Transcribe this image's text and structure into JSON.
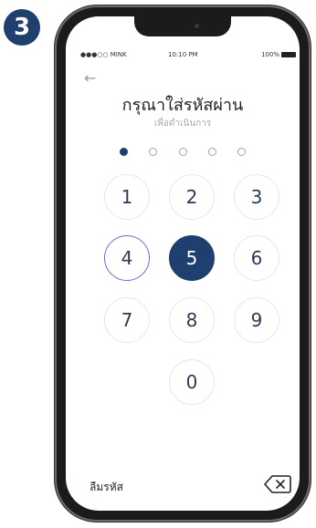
{
  "step_badge": "3",
  "status_bar": {
    "carrier": "●●●○○ MINK",
    "time": "10:10 PM",
    "battery": "100%"
  },
  "back_icon": "back-arrow-icon",
  "title": "กรุณาใส่รหัสผ่าน",
  "subtitle": "เพื่อดำเนินการ",
  "pin": {
    "length": 5,
    "filled": 1
  },
  "keypad": {
    "keys": [
      "1",
      "2",
      "3",
      "4",
      "5",
      "6",
      "7",
      "8",
      "9",
      "0"
    ],
    "pressed": "5",
    "focused": "4"
  },
  "footer": {
    "forgot_label": "ลืมรหัส",
    "backspace_icon": "backspace-icon"
  },
  "colors": {
    "accent": "#1f3f6e",
    "focus_ring": "#6670c9",
    "key_text": "#2a3b55"
  }
}
